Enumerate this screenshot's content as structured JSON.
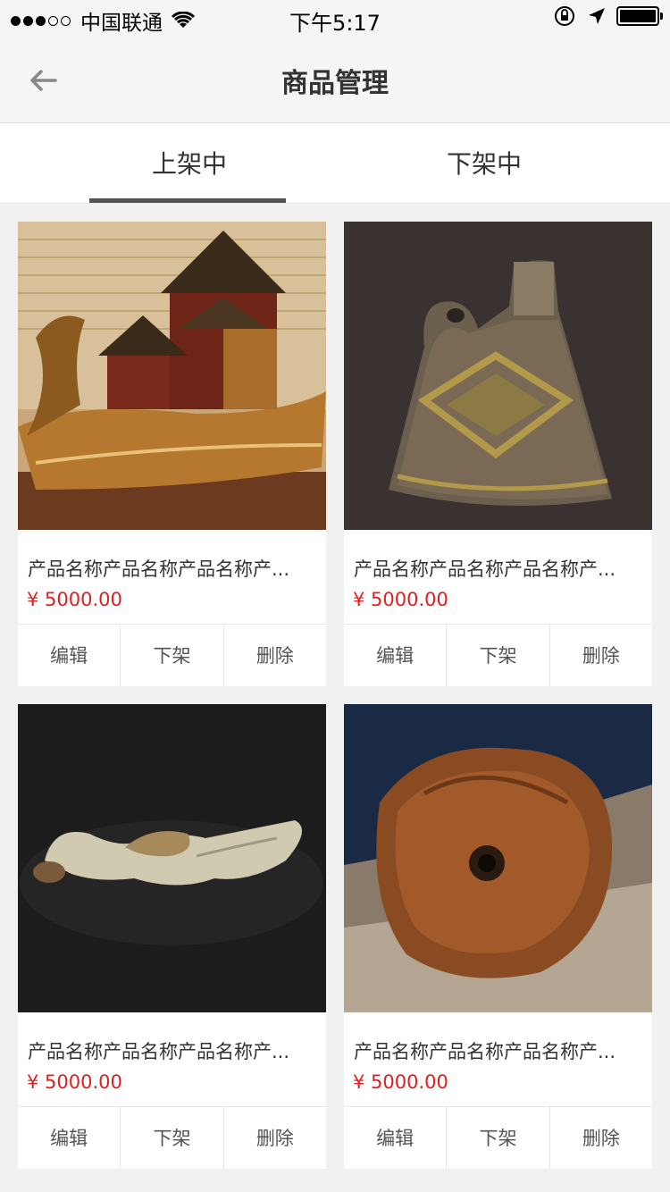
{
  "status_bar": {
    "carrier": "中国联通",
    "time": "下午5:17",
    "signal_dots_filled": 3,
    "signal_dots_total": 5
  },
  "nav": {
    "title": "商品管理",
    "back_icon": "arrow-left-icon"
  },
  "tabs": [
    {
      "label": "上架中",
      "active": true
    },
    {
      "label": "下架中",
      "active": false
    }
  ],
  "products": [
    {
      "name": "产品名称产品名称产品名称产...",
      "price": "¥ 5000.00",
      "image": "dragon-boat-carving"
    },
    {
      "name": "产品名称产品名称产品名称产...",
      "price": "¥ 5000.00",
      "image": "bronze-vessel"
    },
    {
      "name": "产品名称产品名称产品名称产...",
      "price": "¥ 5000.00",
      "image": "jade-pendant"
    },
    {
      "name": "产品名称产品名称产品名称产...",
      "price": "¥ 5000.00",
      "image": "stone-disc"
    }
  ],
  "actions": {
    "edit": "编辑",
    "unlist": "下架",
    "delete": "删除"
  },
  "colors": {
    "price": "#e02020",
    "tab_indicator": "#555555",
    "background": "#f1f1f1"
  }
}
